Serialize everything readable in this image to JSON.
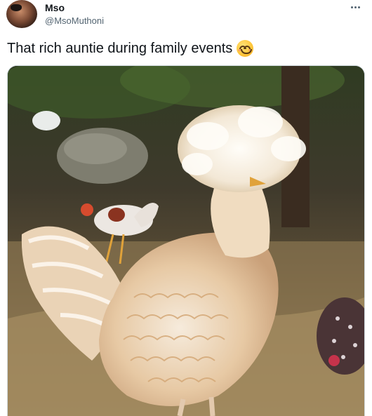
{
  "tweet": {
    "author": {
      "name": "Mso",
      "handle": "@MsoMuthoni"
    },
    "text": "That rich auntie during family events",
    "emoji": "smiling-face-with-smiling-eyes",
    "media": {
      "type": "photo",
      "subject": "fluffy-crested-chicken"
    }
  },
  "icons": {
    "more": "more-horizontal-icon"
  },
  "colors": {
    "text": "#0f1419",
    "secondary": "#536471",
    "border": "#cfd9de"
  }
}
